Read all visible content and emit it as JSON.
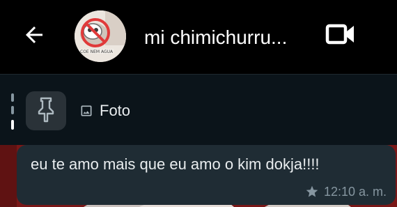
{
  "header": {
    "back_icon": "arrow-left-icon",
    "avatar_image": "avatar-photo",
    "title": "mi chimichurru...",
    "video_icon": "video-camera-icon"
  },
  "pinned": {
    "pin_icon": "pin-icon",
    "preview_icon": "photo-icon",
    "preview_label": "Foto"
  },
  "message": {
    "text": "eu te amo mais que eu amo o kim dokja!!!!",
    "starred_icon": "star-icon",
    "time": "12:10 a. m."
  },
  "colors": {
    "app_bar": "#000000",
    "pinned_bar": "#0b141a",
    "pin_button": "#2a3238",
    "bubble": "#1f2c34",
    "text_primary": "#e9edef",
    "text_secondary": "#8696a0",
    "wallpaper": "#7a1717"
  }
}
